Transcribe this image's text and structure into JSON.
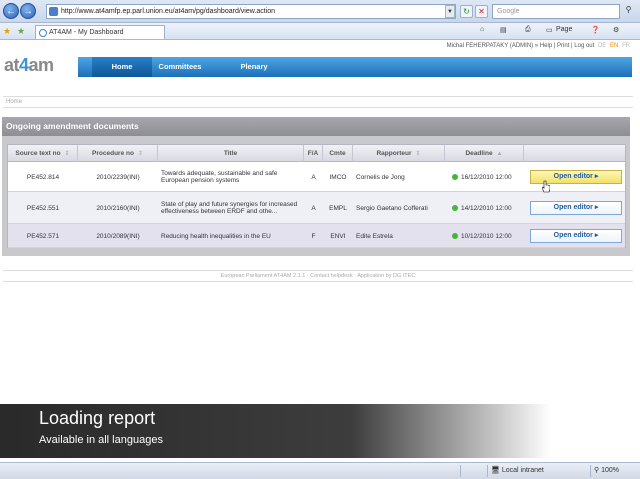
{
  "browser": {
    "url": "http://www.at4amfp.ep.parl.union.eu/at4am/pg/dashboard/view.action",
    "search_placeholder": "Google",
    "tab_title": "AT4AM - My Dashboard",
    "page_menu": "Page",
    "zone": "Local intranet",
    "zoom": "100%"
  },
  "user": {
    "info": "Michal FEHERPATAKY (ADMIN) » Help | Print | Log out",
    "languages": [
      "DE",
      "EN",
      "FR"
    ],
    "active_language": "EN"
  },
  "app": {
    "logo_pre": "at",
    "logo_mid": "4",
    "logo_post": "am"
  },
  "nav": {
    "items": [
      "Home",
      "Committees",
      "Plenary"
    ],
    "active": "Home"
  },
  "breadcrumb": "Home",
  "panel": {
    "title": "Ongoing amendment documents",
    "columns": [
      "Source text no",
      "Procedure no",
      "Title",
      "F/A",
      "Cmte",
      "Rapporteur",
      "Deadline"
    ],
    "rows": [
      {
        "source": "PE452.814",
        "procedure": "2010/2239(INI)",
        "title": "Towards adequate, sustainable and safe European pension systems",
        "fa": "A",
        "cmte": "IMCO",
        "rapporteur": "Cornelis de Jong",
        "deadline": "16/12/2010 12:00",
        "status": "green",
        "action": "Open editor ▸"
      },
      {
        "source": "PE452.551",
        "procedure": "2010/2160(INI)",
        "title": "State of play and future synergies for increased effectiveness between ERDF and othe...",
        "fa": "A",
        "cmte": "EMPL",
        "rapporteur": "Sergio Gaetano Cofferati",
        "deadline": "14/12/2010 12:00",
        "status": "green",
        "action": "Open editor ▸"
      },
      {
        "source": "PE452.571",
        "procedure": "2010/2089(INI)",
        "title": "Reducing health inequalities in the EU",
        "fa": "F",
        "cmte": "ENVI",
        "rapporteur": "Edite Estrela",
        "deadline": "10/12/2010 12:00",
        "status": "green",
        "action": "Open editor ▸"
      }
    ]
  },
  "footer": "European Parliament AT4AM 2.1.1 · Contact helpdesk · Application by DG ITEC",
  "overlay": {
    "title": "Loading report",
    "subtitle": "Available in all languages"
  },
  "colors": {
    "nav_blue": "#1c6fb8",
    "accent_orange": "#e08a00",
    "status_green": "#44b536",
    "hover_yellow": "#f2e06a"
  }
}
